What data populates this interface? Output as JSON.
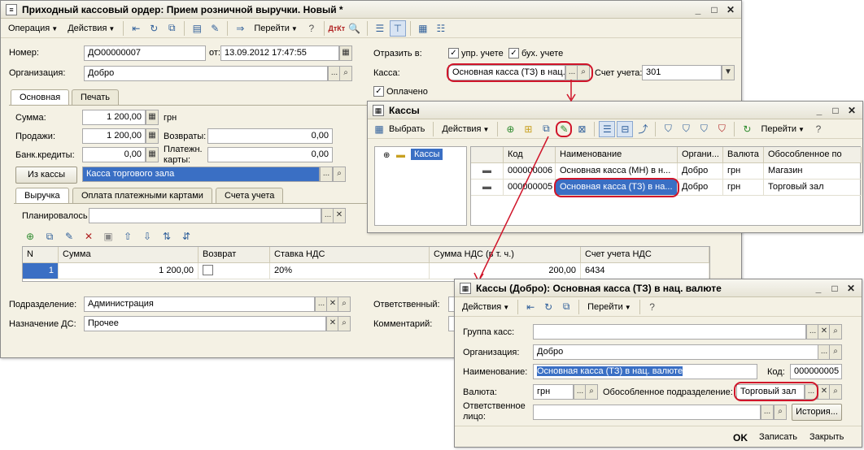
{
  "main": {
    "title": "Приходный кассовый ордер: Прием розничной выручки. Новый *",
    "toolbar": {
      "operation": "Операция",
      "actions": "Действия",
      "goto": "Перейти"
    },
    "number_label": "Номер:",
    "number_value": "ДО00000007",
    "from_label": "от:",
    "date_value": "13.09.2012 17:47:55",
    "org_label": "Организация:",
    "org_value": "Добро",
    "reflect_label": "Отразить в:",
    "mgmt_label": "упр. учете",
    "acc_label": "бух. учете",
    "cashbox_label": "Касса:",
    "cashbox_value": "Основная касса (ТЗ) в нац. ...",
    "account_label": "Счет учета:",
    "account_value": "301",
    "paid_label": "Оплачено",
    "tabs": [
      "Основная",
      "Печать"
    ],
    "sum_label": "Сумма:",
    "sum_value": "1 200,00",
    "currency": "грн",
    "sales_label": "Продажи:",
    "sales_value": "1 200,00",
    "returns_label": "Возвраты:",
    "returns_value": "0,00",
    "bank_label": "Банк.кредиты:",
    "bank_value": "0,00",
    "paycards_label1": "Платежн.",
    "paycards_label2": "карты:",
    "paycards_value": "0,00",
    "from_cash_btn": "Из кассы",
    "from_cash_value": "Касса торгового зала",
    "subtabs": [
      "Выручка",
      "Оплата платежными картами",
      "Счета учета"
    ],
    "planned_label": "Планировалось",
    "table_headers": [
      "N",
      "Сумма",
      "Возврат",
      "Ставка НДС",
      "Сумма НДС (в т. ч.)",
      "Счет учета НДС"
    ],
    "table_row": {
      "n": "1",
      "sum": "1 200,00",
      "rate": "20%",
      "vat": "200,00",
      "vat_account": "6434"
    },
    "dept_label": "Подразделение:",
    "dept_value": "Администрация",
    "purpose_label": "Назначение ДС:",
    "purpose_value": "Прочее",
    "resp_label": "Ответственный:",
    "comment_label": "Комментарий:"
  },
  "kassy": {
    "title": "Кассы",
    "toolbar": {
      "select": "Выбрать",
      "actions": "Действия",
      "goto": "Перейти"
    },
    "tree_item": "Кассы",
    "headers": [
      "Код",
      "Наименование",
      "Органи...",
      "Валюта",
      "Обособленное по"
    ],
    "rows": [
      {
        "code": "000000006",
        "name": "Основная касса (МН) в н...",
        "org": "Добро",
        "cur": "грн",
        "dept": "Магазин"
      },
      {
        "code": "000000005",
        "name": "Основная касса (ТЗ) в на...",
        "org": "Добро",
        "cur": "грн",
        "dept": "Торговый зал"
      }
    ]
  },
  "detail": {
    "title": "Кассы (Добро): Основная касса (ТЗ) в нац. валюте",
    "toolbar": {
      "actions": "Действия",
      "goto": "Перейти"
    },
    "group_label": "Группа касс:",
    "org_label": "Организация:",
    "org_value": "Добро",
    "name_label": "Наименование:",
    "name_value": "Основная касса (ТЗ) в нац. валюте",
    "code_label": "Код:",
    "code_value": "000000005",
    "currency_label": "Валюта:",
    "currency_value": "грн",
    "dept_label": "Обособленное подразделение:",
    "dept_value": "Торговый зал",
    "resp_label1": "Ответственное",
    "resp_label2": "лицо:",
    "history_btn": "История...",
    "ok": "OK",
    "save": "Записать",
    "close": "Закрыть"
  }
}
